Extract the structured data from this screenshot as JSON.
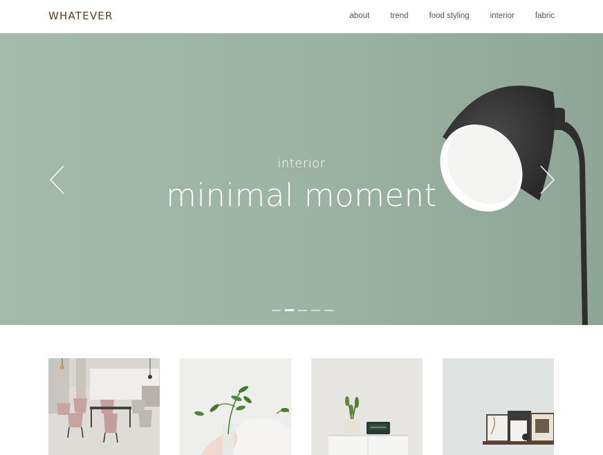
{
  "header": {
    "logo": "WHATEVER",
    "nav": [
      "about",
      "trend",
      "food styling",
      "interior",
      "fabric"
    ]
  },
  "hero": {
    "subtitle": "interior",
    "title": "minimal moment",
    "slide_count": 5,
    "active_slide": 2
  },
  "thumbnails": [
    {
      "subject": "dining room with pink chairs"
    },
    {
      "subject": "plant in glass vase"
    },
    {
      "subject": "plant and speaker on cabinet"
    },
    {
      "subject": "wall shelf with frames"
    }
  ],
  "colors": {
    "logo": "#5a3d22",
    "nav_text": "#555555",
    "hero_wall": "#9fb5a6",
    "hero_text": "#ffffff"
  }
}
